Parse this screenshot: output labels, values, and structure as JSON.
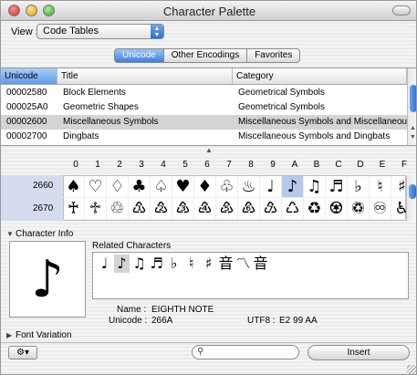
{
  "window": {
    "title": "Character Palette"
  },
  "view": {
    "label": "View :",
    "selected": "Code Tables"
  },
  "tabs": [
    {
      "label": "Unicode",
      "active": true
    },
    {
      "label": "Other Encodings",
      "active": false
    },
    {
      "label": "Favorites",
      "active": false
    }
  ],
  "table": {
    "columns": [
      "Unicode",
      "Title",
      "Category"
    ],
    "rows": [
      {
        "code": "00002580",
        "title": "Block Elements",
        "category": "Geometrical Symbols"
      },
      {
        "code": "000025A0",
        "title": "Geometric Shapes",
        "category": "Geometrical Symbols"
      },
      {
        "code": "00002600",
        "title": "Miscellaneous Symbols",
        "category": "Miscellaneous Symbols and Miscellaneous"
      },
      {
        "code": "00002700",
        "title": "Dingbats",
        "category": "Miscellaneous Symbols and Dingbats"
      }
    ],
    "selected_index": 2
  },
  "grid": {
    "column_heads": [
      "0",
      "1",
      "2",
      "3",
      "4",
      "5",
      "6",
      "7",
      "8",
      "9",
      "A",
      "B",
      "C",
      "D",
      "E",
      "F"
    ],
    "rows": [
      {
        "label": "2660",
        "chars": [
          "♠",
          "♡",
          "♢",
          "♣",
          "♤",
          "♥",
          "♦",
          "♧",
          "♨",
          "♩",
          "♪",
          "♫",
          "♬",
          "♭",
          "♮",
          "♯"
        ]
      },
      {
        "label": "2670",
        "chars": [
          "♰",
          "♱",
          "♲",
          "♳",
          "♴",
          "♵",
          "♶",
          "♷",
          "♸",
          "♹",
          "♺",
          "♻",
          "♼",
          "♽",
          "♾",
          "♿"
        ]
      }
    ],
    "highlight": {
      "row": 0,
      "col": 10
    }
  },
  "character_info": {
    "header": "Character Info",
    "preview_char": "♪",
    "related_label": "Related Characters",
    "related": [
      "♩",
      "♪",
      "♫",
      "♬",
      "♭",
      "♮",
      "♯",
      "音",
      "〽",
      "音"
    ],
    "related_highlight": 1,
    "name_label": "Name :",
    "name_value": "EIGHTH NOTE",
    "unicode_label": "Unicode :",
    "unicode_value": "266A",
    "utf8_label": "UTF8 :",
    "utf8_value": "E2 99 AA"
  },
  "font_variation": {
    "header": "Font Variation"
  },
  "bottom": {
    "gear": "⚙▾",
    "search_placeholder": "",
    "insert_label": "Insert"
  }
}
